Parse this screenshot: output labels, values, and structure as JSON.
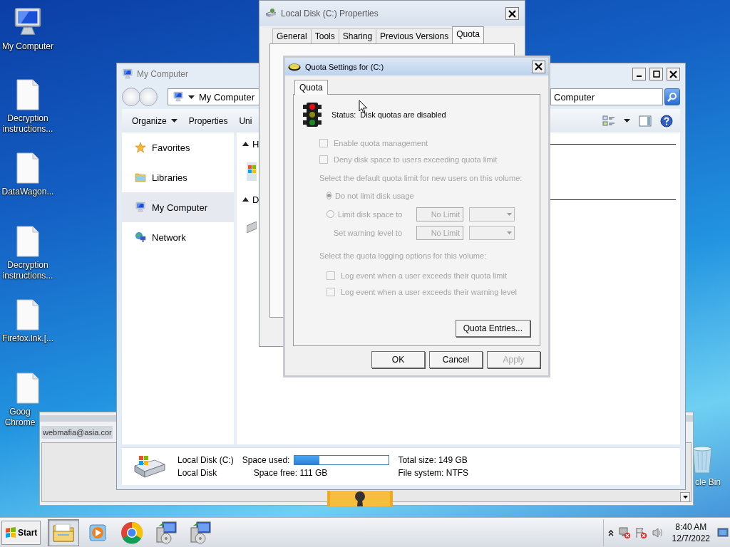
{
  "desktop": {
    "icons": [
      {
        "label": "My Computer",
        "kind": "computer"
      },
      {
        "label": "Decryption instructions...",
        "kind": "text-file"
      },
      {
        "label": "DataWagon...",
        "kind": "file"
      },
      {
        "label": "Decryption instructions...",
        "kind": "text-file"
      },
      {
        "label": "Firefox.lnk.[...",
        "kind": "file"
      },
      {
        "label": "Goog Chrome",
        "kind": "file"
      }
    ],
    "recycle_bin": {
      "label": "cle Bin"
    }
  },
  "background_window": {
    "field": "webmafia@asia.cor"
  },
  "explorer": {
    "title": "My Computer",
    "address": "My Computer",
    "search": "Computer",
    "toolbar": [
      {
        "label": "Organize",
        "kind": "menu"
      },
      {
        "label": "Properties",
        "kind": "plain"
      },
      {
        "label": "Uni",
        "kind": "plain"
      }
    ],
    "nav": [
      {
        "label": "Favorites",
        "kind": "favorites",
        "selected": false
      },
      {
        "label": "Libraries",
        "kind": "libraries",
        "selected": false
      },
      {
        "label": "My Computer",
        "kind": "computer",
        "selected": true
      },
      {
        "label": "Network",
        "kind": "network",
        "selected": false
      }
    ],
    "groups": [
      {
        "label": "H",
        "kind": "drive"
      },
      {
        "label": "D",
        "kind": "device"
      }
    ],
    "details": {
      "name": "Local Disk (C:)",
      "type": "Local Disk",
      "space_used": "Space used:",
      "level": 0.26,
      "space_free": "Space free:  111 GB",
      "total_size": "Total size:  149 GB",
      "file_system": "File system:  NTFS"
    }
  },
  "properties": {
    "title": "Local Disk (C:) Properties",
    "tabs": [
      {
        "label": "General",
        "selected": false
      },
      {
        "label": "Tools",
        "selected": false
      },
      {
        "label": "Sharing",
        "selected": false
      },
      {
        "label": "Previous Versions",
        "selected": false
      },
      {
        "label": "Quota",
        "selected": true
      }
    ]
  },
  "quota_dialog": {
    "title": "Quota Settings for  (C:)",
    "tabs": [
      {
        "label": "Quota",
        "selected": true
      }
    ],
    "status_label": "Status:",
    "status": "Disk quotas are disabled",
    "options": [
      {
        "label": "Enable quota management",
        "checked": false,
        "disabled": true
      },
      {
        "label": "Deny disk space to users exceeding quota limit",
        "checked": false,
        "disabled": true
      }
    ],
    "limit_heading": "Select the default quota limit for new users on this volume:",
    "limits": [
      {
        "kind": "radio",
        "label": "Do not limit disk usage",
        "selected": true
      },
      {
        "kind": "radio",
        "label": "Limit disk space to",
        "selected": false,
        "value": "No Limit"
      },
      {
        "kind": "plain",
        "label": "Set warning level to",
        "value": "No Limit"
      }
    ],
    "logging_heading": "Select the quota logging options for this volume:",
    "logging": [
      {
        "label": "Log event when a user exceeds their quota limit",
        "checked": false,
        "disabled": true
      },
      {
        "label": "Log event when a user exceeds their warning level",
        "checked": false,
        "disabled": true
      }
    ],
    "entries_button": "Quota Entries...",
    "buttons": [
      {
        "label": "OK",
        "disabled": false
      },
      {
        "label": "Cancel",
        "disabled": false
      },
      {
        "label": "Apply",
        "disabled": true
      }
    ]
  },
  "taskbar": {
    "start": "Start",
    "apps": [
      {
        "kind": "explorer",
        "selected": true
      },
      {
        "kind": "media",
        "selected": false
      },
      {
        "kind": "browser",
        "selected": false
      },
      {
        "kind": "installer",
        "selected": false
      },
      {
        "kind": "installer",
        "selected": false
      }
    ],
    "time": "8:40 AM",
    "date": "12/7/2022"
  }
}
